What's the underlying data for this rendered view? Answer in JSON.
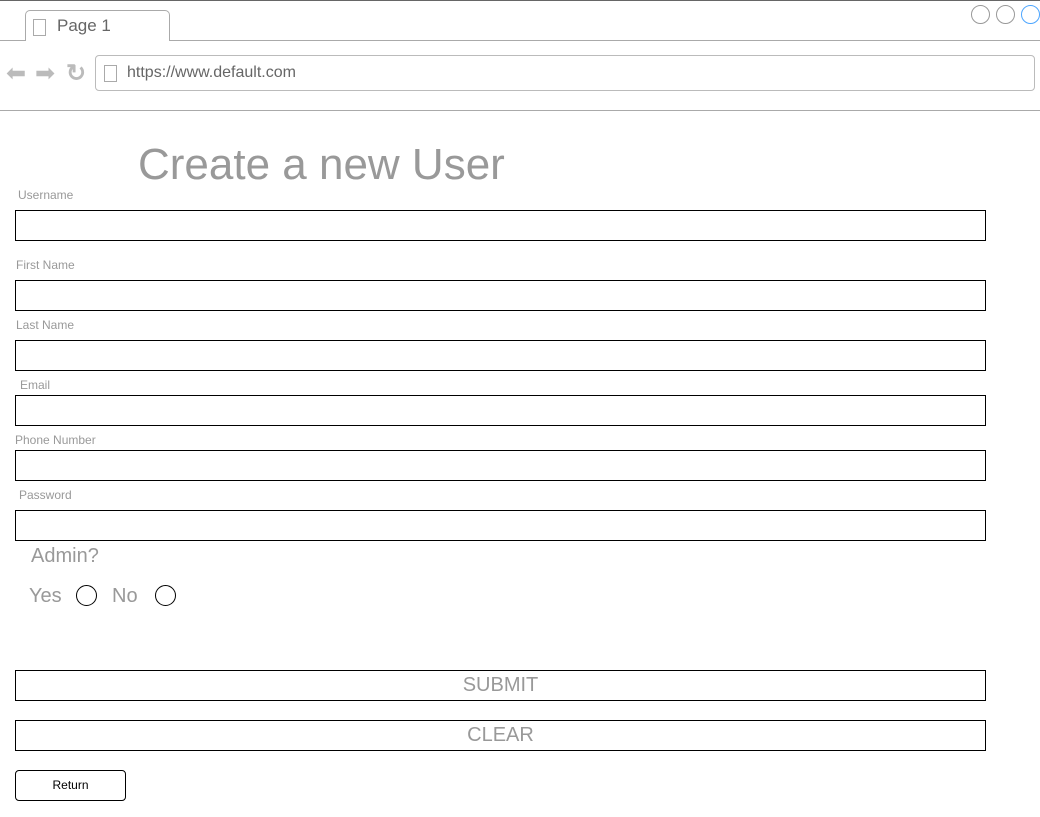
{
  "browser": {
    "tab_label": "Page 1",
    "url": "https://www.default.com",
    "window_button_colors": [
      "#999999",
      "#999999",
      "#4da6ff"
    ]
  },
  "page": {
    "title": "Create a new User",
    "fields": [
      {
        "label": "Username",
        "value": ""
      },
      {
        "label": "First Name",
        "value": ""
      },
      {
        "label": "Last Name",
        "value": ""
      },
      {
        "label": "Email",
        "value": ""
      },
      {
        "label": "Phone Number",
        "value": ""
      },
      {
        "label": "Password",
        "value": ""
      }
    ],
    "admin": {
      "question": "Admin?",
      "yes": "Yes",
      "no": "No",
      "selected": null
    },
    "submit": "SUBMIT",
    "clear": "CLEAR",
    "return": "Return"
  }
}
